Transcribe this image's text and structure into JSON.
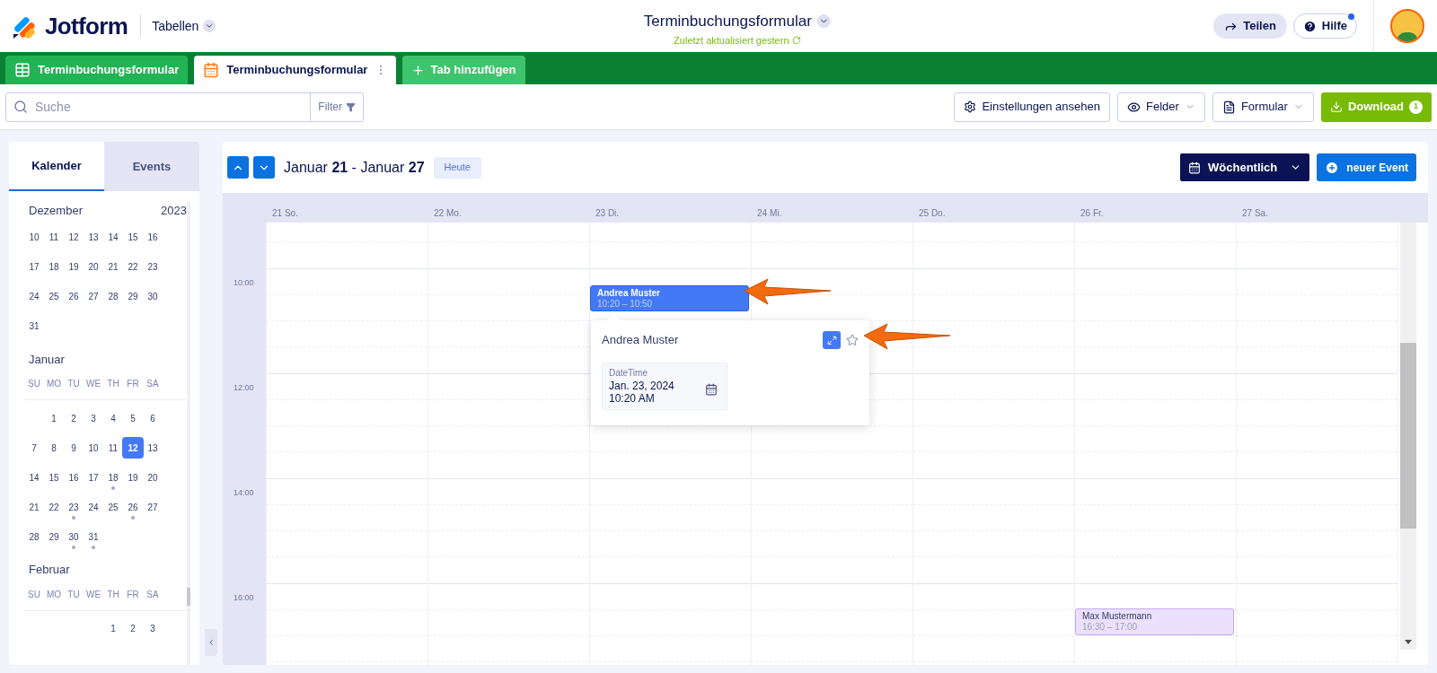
{
  "header": {
    "brand": "Jotform",
    "section": "Tabellen",
    "title": "Terminbuchungsformular",
    "subtitle": "Zuletzt aktualisiert gestern",
    "share": "Teilen",
    "help": "Hilfe",
    "help_notification": true
  },
  "sheet_tabs": [
    {
      "label": "Terminbuchungsformular",
      "kind": "table",
      "selected": false
    },
    {
      "label": "Terminbuchungsformular",
      "kind": "calendar",
      "selected": true
    }
  ],
  "add_tab": "Tab hinzufügen",
  "toolbar": {
    "search_placeholder": "Suche",
    "filter": "Filter",
    "settings": "Einstellungen ansehen",
    "fields": "Felder",
    "form": "Formular",
    "download": "Download",
    "download_count": "1"
  },
  "sidebar": {
    "tabs": [
      {
        "label": "Kalender",
        "selected": true
      },
      {
        "label": "Events",
        "selected": false
      }
    ],
    "months": [
      {
        "name": "Dezember",
        "year": "2023",
        "weeks": [
          [
            {
              "kind": "day",
              "day": "10",
              "selected": false,
              "dot": false
            },
            {
              "kind": "day",
              "day": "11",
              "selected": false,
              "dot": false
            },
            {
              "kind": "day",
              "day": "12",
              "selected": false,
              "dot": false
            },
            {
              "kind": "day",
              "day": "13",
              "selected": false,
              "dot": false
            },
            {
              "kind": "day",
              "day": "14",
              "selected": false,
              "dot": false
            },
            {
              "kind": "day",
              "day": "15",
              "selected": false,
              "dot": false
            },
            {
              "kind": "day",
              "day": "16",
              "selected": false,
              "dot": false
            }
          ],
          [
            {
              "kind": "day",
              "day": "17",
              "selected": false,
              "dot": false
            },
            {
              "kind": "day",
              "day": "18",
              "selected": false,
              "dot": false
            },
            {
              "kind": "day",
              "day": "19",
              "selected": false,
              "dot": false
            },
            {
              "kind": "day",
              "day": "20",
              "selected": false,
              "dot": false
            },
            {
              "kind": "day",
              "day": "21",
              "selected": false,
              "dot": false
            },
            {
              "kind": "day",
              "day": "22",
              "selected": false,
              "dot": false
            },
            {
              "kind": "day",
              "day": "23",
              "selected": false,
              "dot": false
            }
          ],
          [
            {
              "kind": "day",
              "day": "24",
              "selected": false,
              "dot": false
            },
            {
              "kind": "day",
              "day": "25",
              "selected": false,
              "dot": false
            },
            {
              "kind": "day",
              "day": "26",
              "selected": false,
              "dot": false
            },
            {
              "kind": "day",
              "day": "27",
              "selected": false,
              "dot": false
            },
            {
              "kind": "day",
              "day": "28",
              "selected": false,
              "dot": false
            },
            {
              "kind": "day",
              "day": "29",
              "selected": false,
              "dot": false
            },
            {
              "kind": "day",
              "day": "30",
              "selected": false,
              "dot": false
            }
          ],
          [
            {
              "kind": "day",
              "day": "31",
              "selected": false,
              "dot": false
            }
          ]
        ]
      },
      {
        "name": "Januar",
        "weekdays": [
          "SU",
          "MO",
          "TU",
          "WE",
          "TH",
          "FR",
          "SA"
        ],
        "weeks": [
          [
            {
              "kind": "blank"
            },
            {
              "kind": "day",
              "day": "1",
              "selected": false,
              "dot": false
            },
            {
              "kind": "day",
              "day": "2",
              "selected": false,
              "dot": false
            },
            {
              "kind": "day",
              "day": "3",
              "selected": false,
              "dot": false
            },
            {
              "kind": "day",
              "day": "4",
              "selected": false,
              "dot": false
            },
            {
              "kind": "day",
              "day": "5",
              "selected": false,
              "dot": false
            },
            {
              "kind": "day",
              "day": "6",
              "selected": false,
              "dot": false
            }
          ],
          [
            {
              "kind": "day",
              "day": "7",
              "selected": false,
              "dot": false
            },
            {
              "kind": "day",
              "day": "8",
              "selected": false,
              "dot": false
            },
            {
              "kind": "day",
              "day": "9",
              "selected": false,
              "dot": false
            },
            {
              "kind": "day",
              "day": "10",
              "selected": false,
              "dot": false
            },
            {
              "kind": "day",
              "day": "11",
              "selected": false,
              "dot": false
            },
            {
              "kind": "day",
              "day": "12",
              "selected": true,
              "dot": false
            },
            {
              "kind": "day",
              "day": "13",
              "selected": false,
              "dot": false
            }
          ],
          [
            {
              "kind": "day",
              "day": "14",
              "selected": false,
              "dot": false
            },
            {
              "kind": "day",
              "day": "15",
              "selected": false,
              "dot": false
            },
            {
              "kind": "day",
              "day": "16",
              "selected": false,
              "dot": false
            },
            {
              "kind": "day",
              "day": "17",
              "selected": false,
              "dot": false
            },
            {
              "kind": "day",
              "day": "18",
              "selected": false,
              "dot": true
            },
            {
              "kind": "day",
              "day": "19",
              "selected": false,
              "dot": false
            },
            {
              "kind": "day",
              "day": "20",
              "selected": false,
              "dot": false
            }
          ],
          [
            {
              "kind": "day",
              "day": "21",
              "selected": false,
              "dot": false
            },
            {
              "kind": "day",
              "day": "22",
              "selected": false,
              "dot": false
            },
            {
              "kind": "day",
              "day": "23",
              "selected": false,
              "dot": true
            },
            {
              "kind": "day",
              "day": "24",
              "selected": false,
              "dot": false
            },
            {
              "kind": "day",
              "day": "25",
              "selected": false,
              "dot": false
            },
            {
              "kind": "day",
              "day": "26",
              "selected": false,
              "dot": true
            },
            {
              "kind": "day",
              "day": "27",
              "selected": false,
              "dot": false
            }
          ],
          [
            {
              "kind": "day",
              "day": "28",
              "selected": false,
              "dot": false
            },
            {
              "kind": "day",
              "day": "29",
              "selected": false,
              "dot": false
            },
            {
              "kind": "day",
              "day": "30",
              "selected": false,
              "dot": true
            },
            {
              "kind": "day",
              "day": "31",
              "selected": false,
              "dot": true
            }
          ]
        ]
      },
      {
        "name": "Februar",
        "weekdays": [
          "SU",
          "MO",
          "TU",
          "WE",
          "TH",
          "FR",
          "SA"
        ],
        "weeks": [
          [
            {
              "kind": "blank"
            },
            {
              "kind": "blank"
            },
            {
              "kind": "blank"
            },
            {
              "kind": "blank"
            },
            {
              "kind": "day",
              "day": "1",
              "selected": false,
              "dot": false
            },
            {
              "kind": "day",
              "day": "2",
              "selected": false,
              "dot": false
            },
            {
              "kind": "day",
              "day": "3",
              "selected": false,
              "dot": false
            }
          ]
        ]
      }
    ]
  },
  "calendar": {
    "range": "Januar **21** - Januar **27**",
    "today": "Heute",
    "view": "Wöchentlich",
    "new_event": "neuer Event",
    "time_labels": [
      "10:00",
      "12:00",
      "14:00",
      "16:00"
    ],
    "days": [
      {
        "label": "21 So."
      },
      {
        "label": "22 Mo."
      },
      {
        "label": "23 Di.",
        "events": [
          {
            "title": "Andrea Muster",
            "time": "10:20 – 10:50",
            "color": "#4479f6"
          }
        ]
      },
      {
        "label": "24 Mi."
      },
      {
        "label": "25 Do."
      },
      {
        "label": "26 Fr.",
        "events": [
          {
            "title": "Max Mustermann",
            "time": "16:30 – 17:00",
            "color": "#ebe1fc"
          }
        ]
      },
      {
        "label": "27 Sa."
      }
    ],
    "popover": {
      "title": "Andrea Muster",
      "field_label": "DateTime",
      "field_value": "Jan. 23, 2024 10:20 AM"
    }
  }
}
